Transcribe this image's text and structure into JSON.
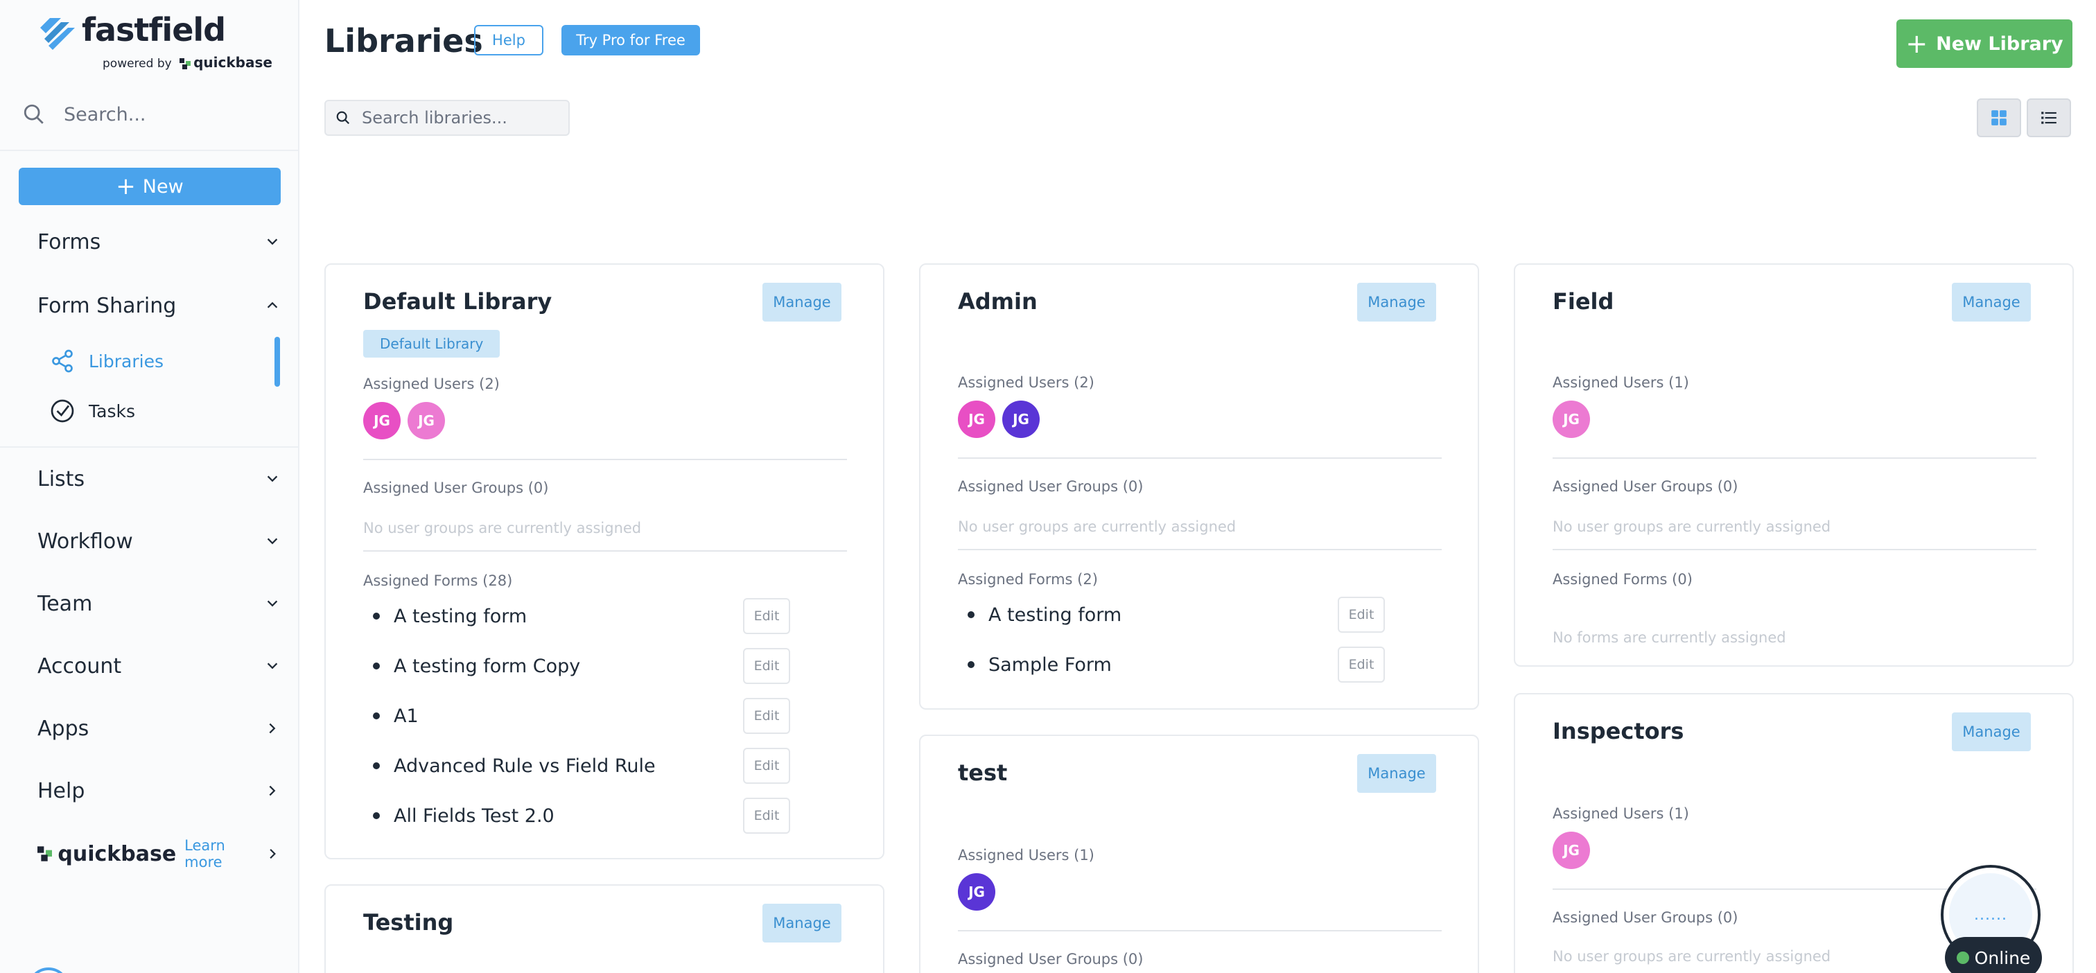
{
  "brand": {
    "name": "fastfield",
    "powered_prefix": "powered by",
    "powered_brand": "quickbase",
    "accent": "#4aa3ec",
    "success": "#5cba67"
  },
  "sidebar": {
    "search_placeholder": "Search...",
    "new_label": "New",
    "forms": "Forms",
    "form_sharing": "Form Sharing",
    "libraries": "Libraries",
    "tasks": "Tasks",
    "lists": "Lists",
    "workflow": "Workflow",
    "team": "Team",
    "account": "Account",
    "apps": "Apps",
    "help": "Help",
    "quickbase": "quickbase",
    "learn_more": "Learn more"
  },
  "header": {
    "title": "Libraries",
    "help": "Help",
    "try_pro": "Try Pro for Free",
    "new_library": "New Library",
    "search_placeholder": "Search libraries..."
  },
  "labels": {
    "manage": "Manage",
    "edit": "Edit",
    "no_groups": "No user groups are currently assigned",
    "no_forms": "No forms are currently assigned"
  },
  "cards": {
    "default": {
      "title": "Default Library",
      "badge": "Default Library",
      "users_label": "Assigned Users (2)",
      "avatars": [
        {
          "initials": "JG",
          "color": "#e84fc4"
        },
        {
          "initials": "JG",
          "color": "#ec7ad2"
        }
      ],
      "groups_label": "Assigned User Groups (0)",
      "forms_label": "Assigned Forms (28)",
      "forms": [
        "A testing form",
        "A testing form Copy",
        "A1",
        "Advanced Rule vs Field Rule",
        "All Fields Test 2.0"
      ]
    },
    "testing": {
      "title": "Testing"
    },
    "admin": {
      "title": "Admin",
      "users_label": "Assigned Users (2)",
      "avatars": [
        {
          "initials": "JG",
          "color": "#e84fc4"
        },
        {
          "initials": "JG",
          "color": "#5a35d6"
        }
      ],
      "groups_label": "Assigned User Groups (0)",
      "forms_label": "Assigned Forms (2)",
      "forms": [
        "A testing form",
        "Sample Form"
      ]
    },
    "test": {
      "title": "test",
      "users_label": "Assigned Users (1)",
      "avatars": [
        {
          "initials": "JG",
          "color": "#5a35d6"
        }
      ],
      "groups_label": "Assigned User Groups (0)"
    },
    "field": {
      "title": "Field",
      "users_label": "Assigned Users (1)",
      "avatars": [
        {
          "initials": "JG",
          "color": "#ec7ad2"
        }
      ],
      "groups_label": "Assigned User Groups (0)",
      "forms_label": "Assigned Forms (0)"
    },
    "inspectors": {
      "title": "Inspectors",
      "users_label": "Assigned Users (1)",
      "avatars": [
        {
          "initials": "JG",
          "color": "#ec7ad2"
        }
      ],
      "groups_label": "Assigned User Groups (0)"
    }
  },
  "status": {
    "online": "Online",
    "widget_text": "......"
  }
}
